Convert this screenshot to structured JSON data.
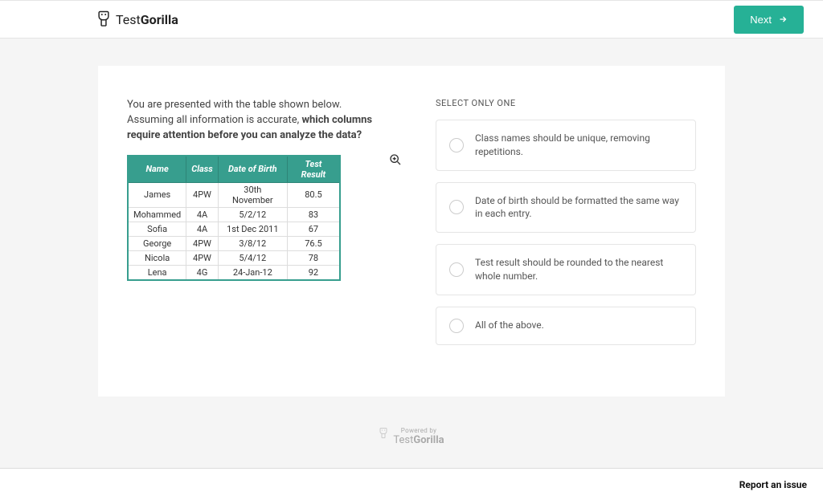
{
  "header": {
    "logo_light": "Test",
    "logo_bold": "Gorilla",
    "next_label": "Next"
  },
  "question": {
    "intro": "You are presented with the table shown below. Assuming all information is accurate, ",
    "bold": "which columns require attention before you can analyze the data?"
  },
  "table": {
    "headers": [
      "Name",
      "Class",
      "Date of Birth",
      "Test Result"
    ],
    "rows": [
      [
        "James",
        "4PW",
        "30th November",
        "80.5"
      ],
      [
        "Mohammed",
        "4A",
        "5/2/12",
        "83"
      ],
      [
        "Sofia",
        "4A",
        "1st Dec 2011",
        "67"
      ],
      [
        "George",
        "4PW",
        "3/8/12",
        "76.5"
      ],
      [
        "Nicola",
        "4PW",
        "5/4/12",
        "78"
      ],
      [
        "Lena",
        "4G",
        "24-Jan-12",
        "92"
      ]
    ]
  },
  "answers": {
    "label": "SELECT ONLY ONE",
    "options": [
      "Class names should be unique, removing repetitions.",
      "Date of birth should be formatted the same way in each entry.",
      "Test result should be rounded to the nearest whole number.",
      "All of the above."
    ]
  },
  "footer": {
    "powered": "Powered by",
    "brand_light": "Test",
    "brand_bold": "Gorilla",
    "report": "Report an issue"
  }
}
